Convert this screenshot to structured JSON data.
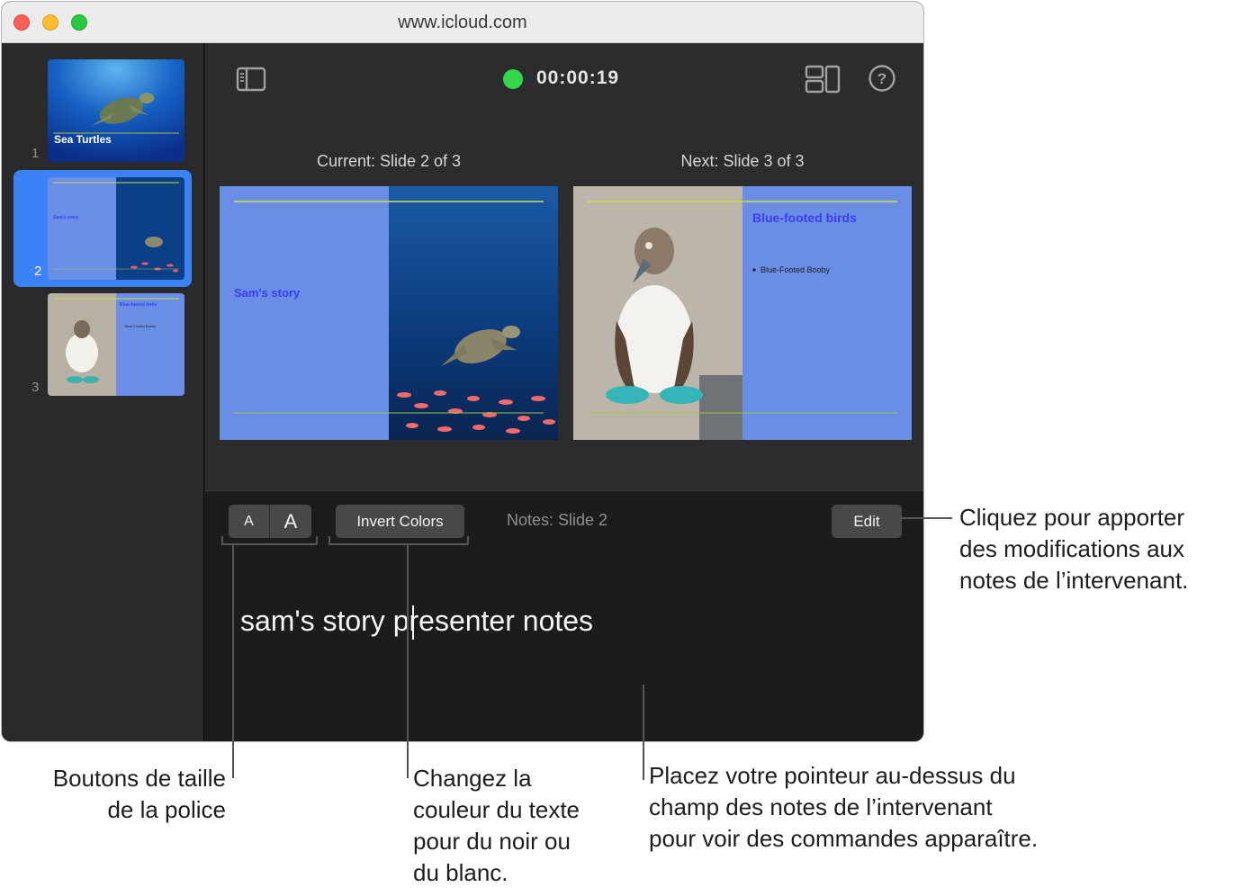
{
  "browser": {
    "url": "www.icloud.com"
  },
  "sidebar": {
    "slides": [
      {
        "number": "1",
        "title": "Sea Turtles"
      },
      {
        "number": "2",
        "title": "Sam's story"
      },
      {
        "number": "3",
        "title": "Blue-footed birds",
        "bullet": "Blue-Footed Booby"
      }
    ]
  },
  "toolbar": {
    "timer": "00:00:19",
    "icons": [
      "sidebar-toggle-icon",
      "layout-icon",
      "help-icon"
    ]
  },
  "presenter": {
    "current_label": "Current: Slide 2 of 3",
    "next_label": "Next: Slide 3 of 3",
    "current_slide_title": "Sam's story",
    "next_slide_title": "Blue-footed birds",
    "next_slide_bullet": "Blue-Footed Booby"
  },
  "notes": {
    "font_small": "A",
    "font_large": "A",
    "invert_label": "Invert Colors",
    "label": "Notes: Slide 2",
    "edit_label": "Edit",
    "text": "sam's story presenter notes"
  },
  "callouts": {
    "edit": [
      "Cliquez pour apporter",
      "des modifications aux",
      "notes de l’intervenant."
    ],
    "font": [
      "Boutons de taille",
      "de la police"
    ],
    "invert": [
      "Changez la",
      "couleur du texte",
      "pour du noir ou",
      "du blanc."
    ],
    "notes": [
      "Placez votre pointeur au-dessus du",
      "champ des notes de l’intervenant",
      "pour voir des commandes apparaître."
    ]
  },
  "colors": {
    "accent": "#3b82f6",
    "timer_green": "#32d74b",
    "slide_blue": "#6a8ee6",
    "slide_title": "#3a3ef0"
  }
}
